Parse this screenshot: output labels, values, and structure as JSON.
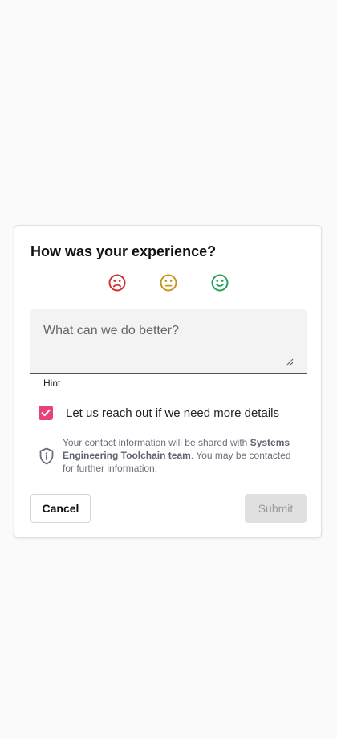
{
  "dialog": {
    "title": "How was your experience?",
    "ratings": [
      {
        "name": "dissatisfied",
        "icon": "frown-face-icon",
        "color": "#d32f2f"
      },
      {
        "name": "neutral",
        "icon": "neutral-face-icon",
        "color": "#c8951e"
      },
      {
        "name": "satisfied",
        "icon": "smile-face-icon",
        "color": "#22a35a"
      }
    ],
    "feedback": {
      "placeholder": "What can we do better?",
      "value": "",
      "hint": "Hint"
    },
    "contact_checkbox": {
      "checked": true,
      "label": "Let us reach out if we need more details",
      "color": "#e8417a"
    },
    "info": {
      "icon": "shield-info-icon",
      "text_before": "Your contact information will be shared with ",
      "team": "Systems Engineering Toolchain team",
      "text_after": ". You may be contacted for further information."
    },
    "actions": {
      "cancel_label": "Cancel",
      "submit_label": "Submit",
      "submit_disabled": true
    }
  }
}
